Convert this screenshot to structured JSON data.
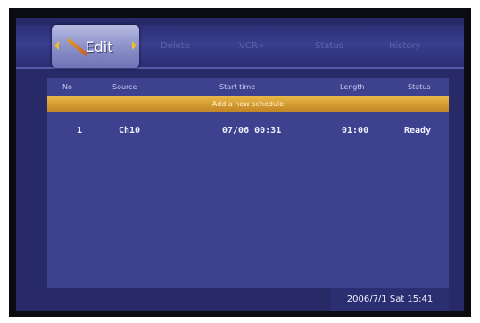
{
  "tabs": {
    "active": "Edit",
    "items": [
      "Delete",
      "VCR+",
      "Status",
      "History"
    ]
  },
  "table": {
    "headers": [
      "No",
      "Source",
      "Start time",
      "Length",
      "Status"
    ],
    "add_row": "Add a new schedule",
    "rows": [
      {
        "no": "1",
        "source": "Ch10",
        "start": "07/06 00:31",
        "length": "01:00",
        "status": "Ready"
      }
    ]
  },
  "clock": "2006/7/1 Sat 15:41",
  "colors": {
    "background": "#272a66",
    "panel": "#3e418e",
    "highlight": "#d49a30",
    "active_tab": "#8c91c9"
  },
  "icons": [
    "pencil-icon",
    "arrow-left-icon",
    "arrow-right-icon"
  ]
}
